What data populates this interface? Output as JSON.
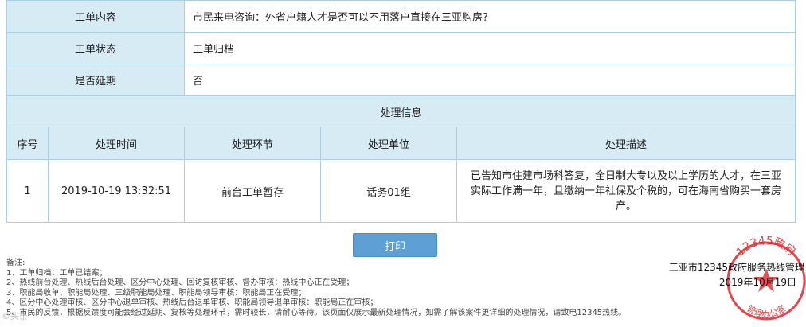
{
  "info": {
    "content_label": "工单内容",
    "content_value": "市民来电咨询：外省户籍人才是否可以不用落户直接在三亚购房?",
    "status_label": "工单状态",
    "status_value": "工单归档",
    "extension_label": "是否延期",
    "extension_value": "否"
  },
  "processing": {
    "section_title": "处理信息",
    "headers": [
      "序号",
      "处理时间",
      "处理环节",
      "处理单位",
      "处理描述"
    ],
    "rows": [
      {
        "index": "1",
        "time": "2019-10-19 13:32:51",
        "stage": "前台工单暂存",
        "unit": "话务01组",
        "description": "已告知市住建市场科答复，全日制大专以及以上学历的人才，在三亚实际工作满一年，且缴纳一年社保及个税的，可在海南省购买一套房产。"
      }
    ]
  },
  "actions": {
    "print_label": "打印"
  },
  "notes": {
    "title": "备注:",
    "lines": [
      "1、工单归档：工单已结案；",
      "2、热线前台处理、热线后台处理、区分中心处理、回访复核审核、督办审核：热线中心正在受理；",
      "3、职能局收单、职能局处理、三级职能局处理、职能局领导审核：职能局正在受理；",
      "4、区分中心处理审核、区分中心退单审核、热线后台退单审核、职能局领导退单审核：职能局正在审核；",
      "5、市民的反馈，根据反馈度可能会经过延期、复核等处理环节，需时较长，请耐心等待。该页面仅展示最新处理情况，如需了解该案件更详细的处理情况，请致电12345热线。"
    ]
  },
  "signature": {
    "org": "三亚市12345政府服务热线管理",
    "date": "2019年10月19日"
  },
  "stamp": {
    "top_text": "12345政府",
    "bottom_text": "管理办公室",
    "color": "#e0262b"
  },
  "watermark": "©头条"
}
